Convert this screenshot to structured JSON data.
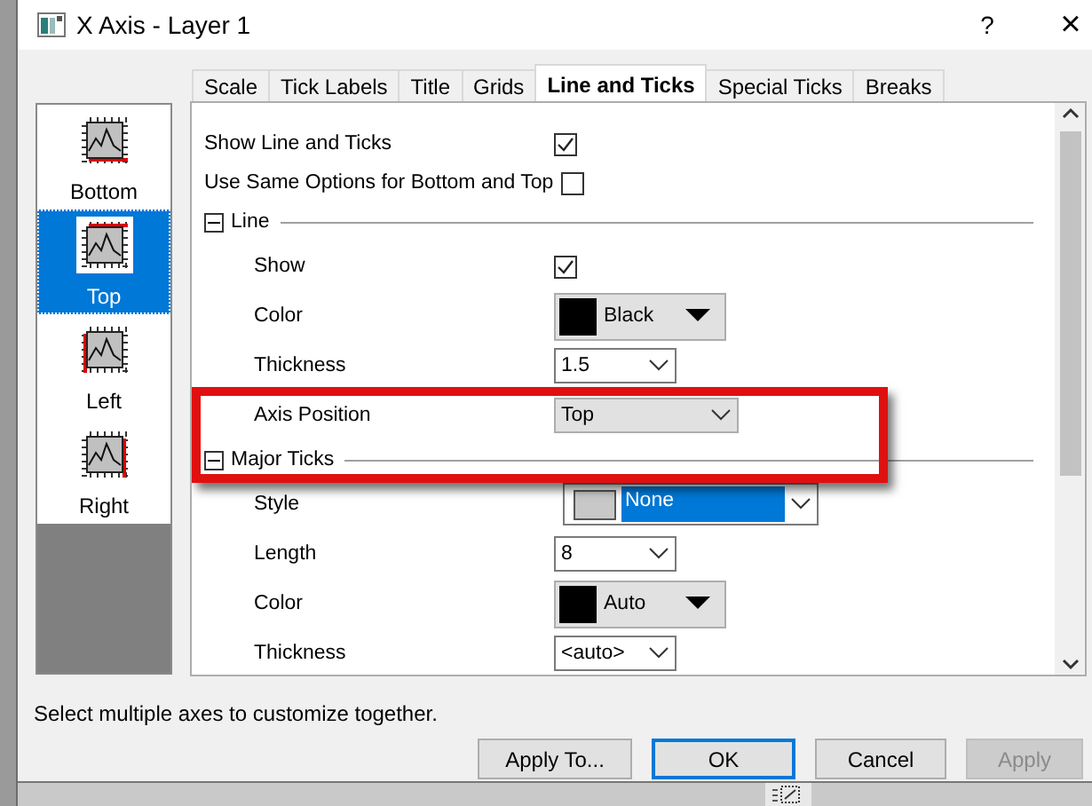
{
  "window": {
    "title": "X Axis - Layer 1",
    "help": "?",
    "close": "×"
  },
  "axes": [
    {
      "label": "Bottom",
      "kind": "bottom",
      "selected": false
    },
    {
      "label": "Top",
      "kind": "top",
      "selected": true
    },
    {
      "label": "Left",
      "kind": "left",
      "selected": false
    },
    {
      "label": "Right",
      "kind": "right",
      "selected": false
    }
  ],
  "tabs": [
    {
      "label": "Scale",
      "selected": false
    },
    {
      "label": "Tick Labels",
      "selected": false
    },
    {
      "label": "Title",
      "selected": false
    },
    {
      "label": "Grids",
      "selected": false
    },
    {
      "label": "Line and Ticks",
      "selected": true
    },
    {
      "label": "Special Ticks",
      "selected": false
    },
    {
      "label": "Breaks",
      "selected": false
    }
  ],
  "rows": [
    {
      "kind": "checkbox",
      "label": "Show Line and Ticks",
      "checked": true
    },
    {
      "kind": "checkbox",
      "label": "Use Same Options for Bottom and Top",
      "checked": false
    },
    {
      "kind": "group",
      "label": "Line",
      "expanded": true,
      "children": [
        {
          "kind": "checkbox",
          "label": "Show",
          "checked": true
        },
        {
          "kind": "color",
          "label": "Color",
          "value": "Black",
          "color": "#000000"
        },
        {
          "kind": "combo",
          "label": "Thickness",
          "value": "1.5",
          "shaded": false
        },
        {
          "kind": "combo",
          "label": "Axis Position",
          "value": "Top",
          "shaded": true
        }
      ]
    },
    {
      "kind": "group",
      "label": "Major Ticks",
      "expanded": true,
      "children": [
        {
          "kind": "style",
          "label": "Style",
          "value": "None"
        },
        {
          "kind": "combo",
          "label": "Length",
          "value": "8",
          "shaded": false
        },
        {
          "kind": "color",
          "label": "Color",
          "value": "Auto",
          "color": "#000000"
        },
        {
          "kind": "combo",
          "label": "Thickness",
          "value": "<auto>",
          "shaded": false
        }
      ]
    }
  ],
  "highlight": {
    "kind": "rectangle"
  },
  "hint": "Select multiple axes to customize together.",
  "buttons": [
    {
      "label": "Apply To...",
      "default": false,
      "disabled": false
    },
    {
      "label": "OK",
      "default": true,
      "disabled": false
    },
    {
      "label": "Cancel",
      "default": false,
      "disabled": false
    },
    {
      "label": "Apply",
      "default": false,
      "disabled": true
    }
  ]
}
